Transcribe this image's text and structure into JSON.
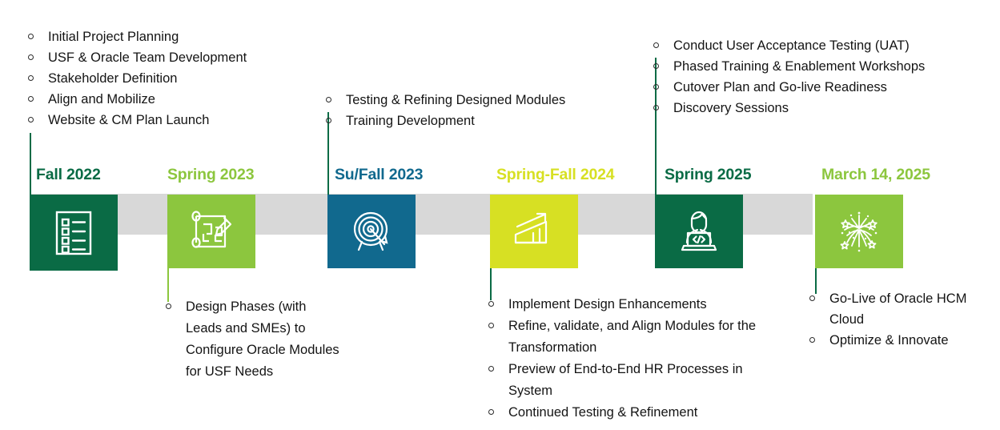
{
  "palette": {
    "dark_green": "#0a6b45",
    "light_green": "#8cc63e",
    "teal_blue": "#11698e",
    "yellow_green": "#d7e023",
    "grey_band": "#d8d8d8",
    "text": "#141414",
    "stem_dark": "#0a6b45"
  },
  "milestones": [
    {
      "id": "fall-2022",
      "label": "Fall 2022",
      "color": "#0a6b45",
      "label_color": "#0a6b45",
      "icon": "checklist-icon",
      "callout_position": "above",
      "bullets": [
        "Initial Project Planning",
        "USF & Oracle Team Development",
        "Stakeholder Definition",
        "Align and Mobilize",
        "Website & CM Plan Launch"
      ]
    },
    {
      "id": "spring-2023",
      "label": "Spring 2023",
      "color": "#8cc63e",
      "label_color": "#8cc63e",
      "icon": "blueprint-pencil-icon",
      "callout_position": "below",
      "bullets": [
        "Design Phases (with Leads and SMEs) to Configure Oracle Modules for USF Needs"
      ]
    },
    {
      "id": "su-fall-2023",
      "label": "Su/Fall 2023",
      "color": "#11698e",
      "label_color": "#11698e",
      "icon": "target-bullseye-icon",
      "callout_position": "above",
      "bullets": [
        "Testing & Refining Designed Modules",
        "Training Development"
      ]
    },
    {
      "id": "spring-fall-2024",
      "label": "Spring-Fall 2024",
      "color": "#d7e023",
      "label_color": "#d7e023",
      "icon": "growth-chart-icon",
      "callout_position": "below",
      "bullets": [
        "Implement Design Enhancements",
        "Refine, validate, and Align Modules for the Transformation",
        "Preview of End-to-End HR Processes in System",
        "Continued Testing & Refinement"
      ]
    },
    {
      "id": "spring-2025",
      "label": "Spring 2025",
      "color": "#0a6b45",
      "label_color": "#0a6b45",
      "icon": "developer-laptop-icon",
      "callout_position": "above",
      "bullets": [
        "Conduct User Acceptance Testing (UAT)",
        "Phased Training & Enablement Workshops",
        "Cutover Plan and Go-live Readiness",
        "Discovery Sessions"
      ]
    },
    {
      "id": "march-14-2025",
      "label": "March 14, 2025",
      "color": "#8cc63e",
      "label_color": "#8cc63e",
      "icon": "fireworks-icon",
      "callout_position": "below",
      "bullets": [
        "Go-Live of Oracle HCM Cloud",
        "Optimize & Innovate"
      ]
    }
  ]
}
